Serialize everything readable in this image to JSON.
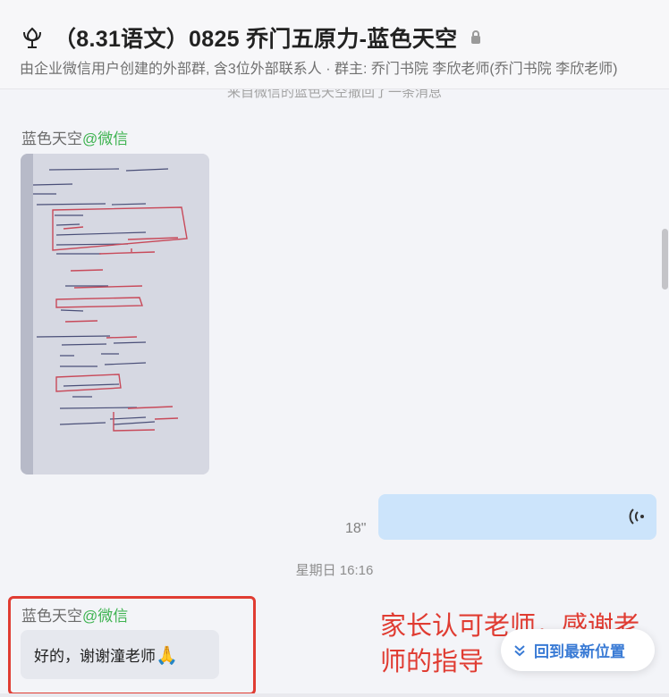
{
  "header": {
    "title": "（8.31语文）0825 乔门五原力-蓝色天空",
    "subtitle": "由企业微信用户创建的外部群, 含3位外部联系人 · 群主: 乔门书院 李欣老师(乔门书院 李欣老师)",
    "icon": "tulip-group-icon",
    "lock_icon": "lock-icon"
  },
  "chat": {
    "recall_notice": "来自微信的蓝色天空撤回了一条消息",
    "messages": [
      {
        "type": "image",
        "sender": "蓝色天空",
        "sender_source": "@微信",
        "content": "handwritten-notes-photo"
      },
      {
        "type": "voice",
        "direction": "outgoing",
        "duration": "18\""
      },
      {
        "type": "timestamp",
        "text": "星期日 16:16"
      },
      {
        "type": "text",
        "sender": "蓝色天空",
        "sender_source": "@微信",
        "text": "好的，谢谢潼老师",
        "emoji": "🙏"
      }
    ]
  },
  "annotation": {
    "text": "家长认可老师，感谢老师的指导",
    "color": "#e03c32"
  },
  "jump_button": {
    "label": "回到最新位置",
    "icon": "double-chevron-down-icon"
  },
  "colors": {
    "accent_blue": "#3a7bd5",
    "wechat_green": "#3fb351",
    "voice_bubble": "#cce4fb",
    "highlight_red": "#e03c32"
  }
}
